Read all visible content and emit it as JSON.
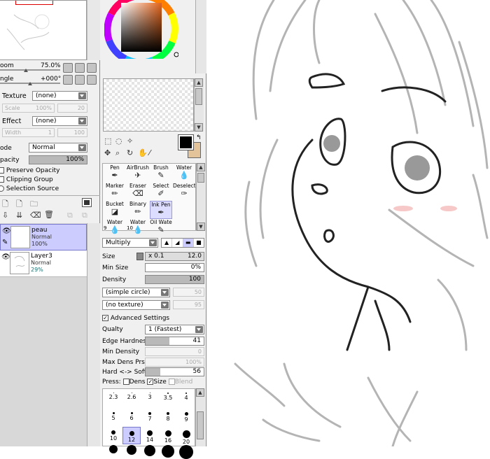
{
  "navigator": {
    "zoom_label": "oom",
    "zoom_value": "75.0%",
    "angle_label": "ngle",
    "angle_value": "+000°"
  },
  "layer_props": {
    "texture_label": "Texture",
    "texture_value": "(none)",
    "scale_label": "Scale",
    "scale_value": "100%",
    "scale_num": "20",
    "effect_label": "Effect",
    "effect_value": "(none)",
    "width_label": "Width",
    "width_value": "1",
    "width_num": "100",
    "mode_label": "ode",
    "mode_value": "Normal",
    "opacity_label": "pacity",
    "opacity_value": "100%",
    "opacity_fraction": 1.0,
    "preserve_opacity": "Preserve Opacity",
    "clipping_group": "Clipping Group",
    "selection_source": "Selection Source"
  },
  "layers": [
    {
      "name": "peau",
      "mode": "Normal",
      "opacity": "100%",
      "selected": true
    },
    {
      "name": "Layer3",
      "mode": "Normal",
      "opacity": "29%",
      "selected": false
    }
  ],
  "tools": {
    "brushes": [
      {
        "label": "Pen",
        "icon": "pen-icon"
      },
      {
        "label": "AirBrush",
        "icon": "airbrush-icon"
      },
      {
        "label": "Brush",
        "icon": "brush-icon"
      },
      {
        "label": "Water",
        "icon": "water-icon"
      },
      {
        "label": "Marker",
        "icon": "marker-icon"
      },
      {
        "label": "Eraser",
        "icon": "eraser-icon"
      },
      {
        "label": "Select",
        "icon": "select-icon"
      },
      {
        "label": "Deselect",
        "icon": "deselect-icon"
      },
      {
        "label": "Bucket",
        "icon": "bucket-icon"
      },
      {
        "label": "Binary",
        "icon": "binary-icon"
      },
      {
        "label": "Ink Pen",
        "icon": "ink-pen-icon"
      },
      {
        "label": "",
        "icon": ""
      },
      {
        "label": "Water",
        "icon": "water-icon"
      },
      {
        "label": "Water",
        "icon": "water-icon"
      },
      {
        "label": "Oil Wate",
        "icon": "oil-water-icon"
      },
      {
        "label": "",
        "icon": ""
      }
    ],
    "brush_num_a": "9",
    "brush_num_b": "10"
  },
  "brush": {
    "blend_mode": "Multiply",
    "size_label": "Size",
    "size_multiplier": "x 0.1",
    "size_value": "12.0",
    "min_size_label": "Min Size",
    "min_size_value": "0%",
    "density_label": "Density",
    "density_value": "100",
    "shape": "(simple circle)",
    "shape_num": "50",
    "texture": "(no texture)",
    "texture_num": "95",
    "advanced_label": "Advanced Settings",
    "quality_label": "Qualty",
    "quality_value": "1 (Fastest)",
    "edge_hardness_label": "Edge Hardness",
    "edge_hardness_value": "41",
    "min_density_label": "Min Density",
    "min_density_value": "0",
    "max_dens_label": "Max Dens Prs.",
    "max_dens_value": "100%",
    "hard_soft_label": "Hard <-> Soft",
    "hard_soft_value": "56",
    "press_label": "Press:",
    "press_dens": "Dens",
    "press_size": "Size",
    "press_blend": "Blend"
  },
  "brush_sizes": {
    "row1": [
      "2.3",
      "2.6",
      "3",
      "3.5",
      "4"
    ],
    "row2": [
      "5",
      "6",
      "7",
      "8",
      "9"
    ],
    "row3": [
      "10",
      "12",
      "14",
      "16",
      "20"
    ],
    "selected": "12"
  },
  "colors": {
    "accent": "#ccccff",
    "primary": "#000000",
    "secondary": "#e3c49a"
  }
}
